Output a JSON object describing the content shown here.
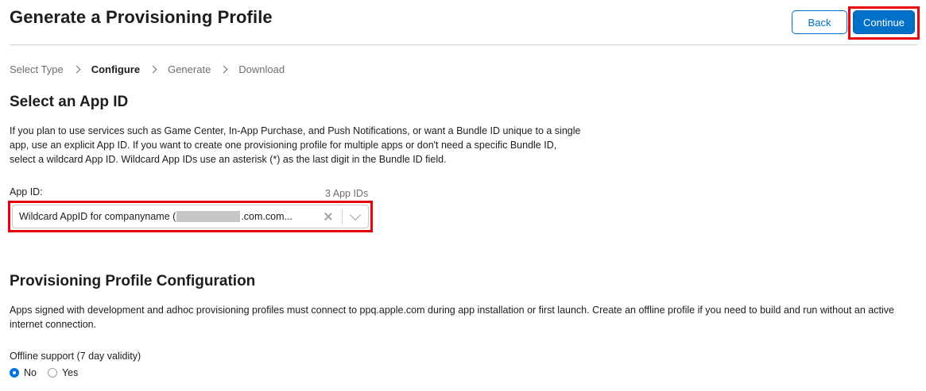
{
  "header": {
    "title": "Generate a Provisioning Profile",
    "back_label": "Back",
    "continue_label": "Continue"
  },
  "breadcrumb": {
    "steps": [
      "Select Type",
      "Configure",
      "Generate",
      "Download"
    ],
    "active_step": "Configure"
  },
  "app_id_section": {
    "title": "Select an App ID",
    "description": "If you plan to use services such as Game Center, In-App Purchase, and Push Notifications, or want a Bundle ID unique to a single app, use an explicit App ID. If you want to create one provisioning profile for multiple apps or don't need a specific Bundle ID, select a wildcard App ID. Wildcard App IDs use an asterisk (*) as the last digit in the Bundle ID field.",
    "field_label": "App ID:",
    "count_label": "3 App IDs",
    "selected_prefix": "Wildcard AppID for companyname (",
    "selected_suffix": ".com.com...",
    "clear_icon": "close-icon",
    "dropdown_icon": "chevron-down-icon"
  },
  "config_section": {
    "title": "Provisioning Profile Configuration",
    "description": "Apps signed with development and adhoc provisioning profiles must connect to ppq.apple.com during app installation or first launch. Create an offline profile if you need to build and run without an active internet connection.",
    "offline_label": "Offline support (7 day validity)",
    "options": [
      {
        "label": "No",
        "selected": true
      },
      {
        "label": "Yes",
        "selected": false
      }
    ]
  },
  "colors": {
    "accent": "#0070c9",
    "highlight": "#e8000b",
    "text": "#1d1d1f",
    "muted": "#6e6e73"
  }
}
